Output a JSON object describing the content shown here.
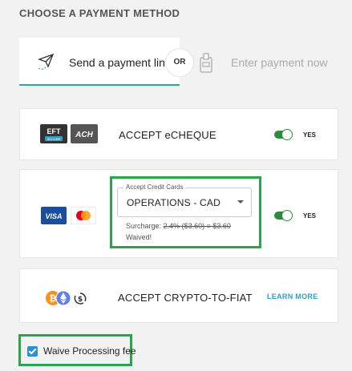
{
  "heading": "CHOOSE A PAYMENT METHOD",
  "tabs": {
    "payment_link": "Send a payment link",
    "or": "OR",
    "enter_now": "Enter payment now"
  },
  "echeque": {
    "badge_eft": "EFT",
    "badge_secure": "SECURE",
    "badge_ach": "ACH",
    "title": "ACCEPT eCHEQUE",
    "toggle_label": "YES",
    "enabled": true
  },
  "credit": {
    "badge_visa": "VISA",
    "legend": "Accept Credit Cards",
    "selected_option": "OPERATIONS - CAD",
    "surcharge_prefix": "Surcharge:",
    "surcharge_struck": "2.4% ($3.60) = $3.60",
    "waived": "Waived!",
    "toggle_label": "YES",
    "enabled": true
  },
  "crypto": {
    "title": "ACCEPT CRYPTO-TO-FIAT",
    "link": "LEARN MORE"
  },
  "waive": {
    "label": "Waive Processing fee",
    "checked": true
  },
  "colors": {
    "accent": "#2ea0c7",
    "highlight": "#27a74a",
    "toggle_on": "#2e8b3d",
    "checkbox": "#2f8fd1"
  }
}
